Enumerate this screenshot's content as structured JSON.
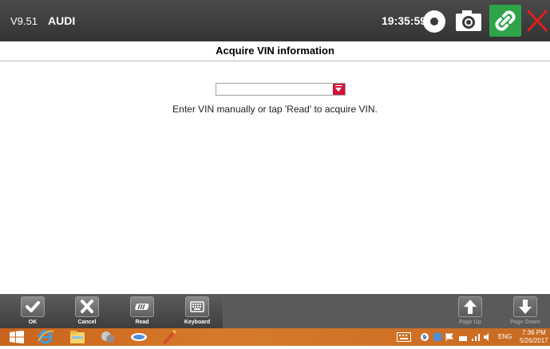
{
  "titlebar": {
    "version": "V9.51",
    "brand": "AUDI",
    "clock": "19:35:59",
    "icons": [
      "record-icon",
      "camera-icon",
      "link-icon",
      "close-icon"
    ],
    "accent_link": "#2ea34a",
    "close_color": "#e11f1f"
  },
  "page": {
    "title": "Acquire VIN information",
    "vin_value": "",
    "hint": "Enter VIN manually or tap 'Read' to acquire VIN."
  },
  "toolbar": {
    "ok_label": "OK",
    "cancel_label": "Cancel",
    "read_label": "Read",
    "keyboard_label": "Keyboard",
    "page_up_label": "Page Up",
    "page_down_label": "Page Down"
  },
  "taskbar": {
    "lang": "ENG",
    "time": "7:36 PM",
    "date": "5/26/2017"
  }
}
